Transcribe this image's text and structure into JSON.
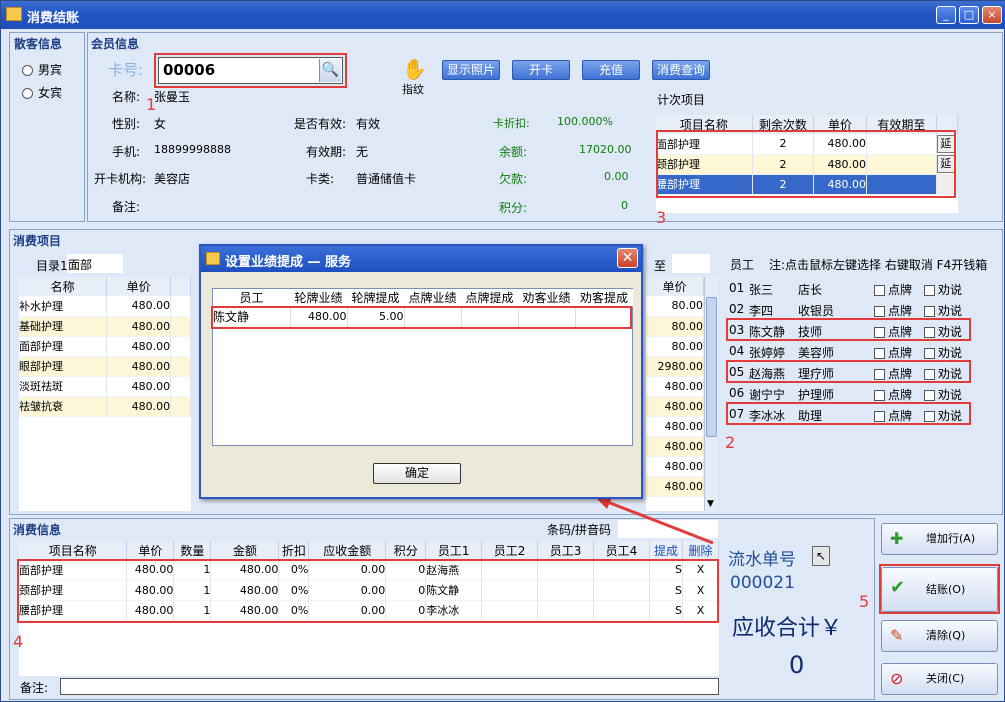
{
  "window": {
    "title": "消费结账",
    "minimize": "_",
    "maximize": "□",
    "close": "×"
  },
  "guest": {
    "section_title": "散客信息",
    "male": "男宾",
    "female": "女宾"
  },
  "member": {
    "section_title": "会员信息",
    "card_label": "卡号:",
    "card_value": "00006",
    "fingerprint_label": "指纹",
    "buttons": {
      "photo": "显示照片",
      "open_card": "开卡",
      "recharge": "充值",
      "query": "消费查询"
    },
    "name_label": "名称:",
    "name_value": "张曼玉",
    "gender_label": "性别:",
    "gender_value": "女",
    "valid_label": "是否有效:",
    "valid_value": "有效",
    "discount_label": "卡折扣:",
    "discount_value": "100.000%",
    "phone_label": "手机:",
    "phone_value": "18899998888",
    "expiry_label": "有效期:",
    "expiry_value": "无",
    "balance_label": "余额:",
    "balance_value": "17020.00",
    "org_label": "开卡机构:",
    "org_value": "美容店",
    "cardtype_label": "卡类:",
    "cardtype_value": "普通储值卡",
    "owed_label": "欠款:",
    "owed_value": "0.00",
    "note_label": "备注:",
    "points_label": "积分:",
    "points_value": "0"
  },
  "counted": {
    "title": "计次项目",
    "headers": [
      "项目名称",
      "剩余次数",
      "单价",
      "有效期至"
    ],
    "rows": [
      {
        "name": "面部护理",
        "remain": "2",
        "price": "480.00",
        "btn": "延"
      },
      {
        "name": "颈部护理",
        "remain": "2",
        "price": "480.00",
        "btn": "延"
      },
      {
        "name": "腰部护理",
        "remain": "2",
        "price": "480.00",
        "btn": ""
      }
    ]
  },
  "items": {
    "section_title": "消费项目",
    "dir_label": "目录1",
    "dir_value": "面部",
    "to_label": "至",
    "headers": [
      "名称",
      "单价"
    ],
    "rows": [
      {
        "name": "补水护理",
        "price": "480.00"
      },
      {
        "name": "基础护理",
        "price": "480.00"
      },
      {
        "name": "面部护理",
        "price": "480.00"
      },
      {
        "name": "眼部护理",
        "price": "480.00"
      },
      {
        "name": "淡斑祛斑",
        "price": "480.00"
      },
      {
        "name": "祛皱抗衰",
        "price": "480.00"
      }
    ],
    "right_header": "单价",
    "right_prices": [
      "80.00",
      "80.00",
      "80.00",
      "2980.00",
      "480.00",
      "480.00",
      "480.00",
      "480.00",
      "480.00",
      "480.00",
      "480.00"
    ]
  },
  "employees": {
    "title": "员工",
    "note": "注:点击鼠标左键选择 右键取消 F4开钱箱",
    "brand_label": "点牌",
    "persuade_label": "劝说",
    "rows": [
      {
        "id": "01",
        "name": "张三",
        "role": "店长"
      },
      {
        "id": "02",
        "name": "李四",
        "role": "收银员"
      },
      {
        "id": "03",
        "name": "陈文静",
        "role": "技师"
      },
      {
        "id": "04",
        "name": "张婷婷",
        "role": "美容师"
      },
      {
        "id": "05",
        "name": "赵海燕",
        "role": "理疗师"
      },
      {
        "id": "06",
        "name": "谢宁宁",
        "role": "护理师"
      },
      {
        "id": "07",
        "name": "李冰冰",
        "role": "助理"
      }
    ]
  },
  "dialog": {
    "title": "设置业绩提成 — 服务",
    "headers": [
      "员工",
      "轮牌业绩",
      "轮牌提成",
      "点牌业绩",
      "点牌提成",
      "劝客业绩",
      "劝客提成"
    ],
    "row": {
      "employee": "陈文静",
      "rotate_perf": "480.00",
      "rotate_comm": "5.00"
    },
    "ok": "确定"
  },
  "consume": {
    "section_title": "消费信息",
    "barcode_label": "条码/拼音码",
    "headers": [
      "项目名称",
      "单价",
      "数量",
      "金额",
      "折扣",
      "应收金额",
      "积分",
      "员工1",
      "员工2",
      "员工3",
      "员工4",
      "提成",
      "删除"
    ],
    "rows": [
      {
        "name": "面部护理",
        "price": "480.00",
        "qty": "1",
        "amount": "480.00",
        "disc": "0%",
        "due": "0.00",
        "points": "0",
        "e1": "赵海燕",
        "c": "S",
        "d": "X"
      },
      {
        "name": "颈部护理",
        "price": "480.00",
        "qty": "1",
        "amount": "480.00",
        "disc": "0%",
        "due": "0.00",
        "points": "0",
        "e1": "陈文静",
        "c": "S",
        "d": "X"
      },
      {
        "name": "腰部护理",
        "price": "480.00",
        "qty": "1",
        "amount": "480.00",
        "disc": "0%",
        "due": "0.00",
        "points": "0",
        "e1": "李冰冰",
        "c": "S",
        "d": "X"
      }
    ],
    "note_label": "备注:"
  },
  "serial": {
    "label": "流水单号",
    "value": "000021"
  },
  "total": {
    "label": "应收合计￥",
    "value": "0"
  },
  "actions": {
    "add_row": "增加行(A)",
    "checkout": "结账(O)",
    "clear": "清除(Q)",
    "close": "关闭(C)"
  },
  "markers": [
    "1",
    "2",
    "3",
    "4",
    "5"
  ],
  "colors": {
    "accent_red": "#e23b3b",
    "title_blue": "#1f4fb8",
    "selected_row": "#3568c8"
  }
}
